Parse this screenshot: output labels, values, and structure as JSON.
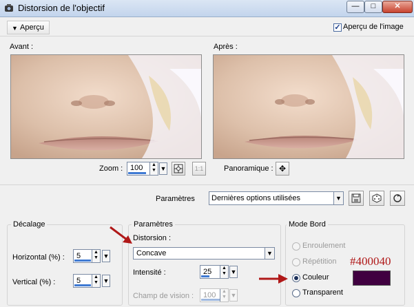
{
  "window": {
    "title": "Distorsion de l'objectif",
    "buttons": {
      "minimize": "—",
      "maximize": "□",
      "close": "✕"
    }
  },
  "preview": {
    "toggle_label": "Aperçu",
    "apercu_image_label": "Aperçu de l'image",
    "apercu_image_checked": true,
    "before_label": "Avant :",
    "after_label": "Après :",
    "zoom_label": "Zoom :",
    "zoom_value": "100",
    "pan_label": "Panoramique :",
    "zoom_fit_label": "1:1"
  },
  "presets": {
    "label": "Paramètres",
    "value": "Dernières options utilisées"
  },
  "decalage": {
    "title": "Décalage",
    "horizontal_label": "Horizontal (%) :",
    "horizontal_value": "5",
    "vertical_label": "Vertical (%) :",
    "vertical_value": "5"
  },
  "parametres": {
    "title": "Paramètres",
    "distortion_label": "Distorsion :",
    "distortion_value": "Concave",
    "intensity_label": "Intensité :",
    "intensity_value": "25",
    "fov_label": "Champ de vision :",
    "fov_value": "100"
  },
  "mode_bord": {
    "title": "Mode Bord",
    "options": [
      "Enroulement",
      "Répétition",
      "Couleur",
      "Transparent"
    ],
    "selected": "Couleur",
    "color_hex": "#400040",
    "color_annotation": "#400040"
  },
  "colors": {
    "annotation_red": "#b01818",
    "accent_blue": "#3f7ad3",
    "edge_color": "#400040"
  },
  "icons": [
    "lens-app-icon",
    "chevron-down-icon",
    "zoom-fit-icon",
    "pan-move-icon",
    "save-preset-icon",
    "randomize-icon",
    "reset-icon"
  ]
}
